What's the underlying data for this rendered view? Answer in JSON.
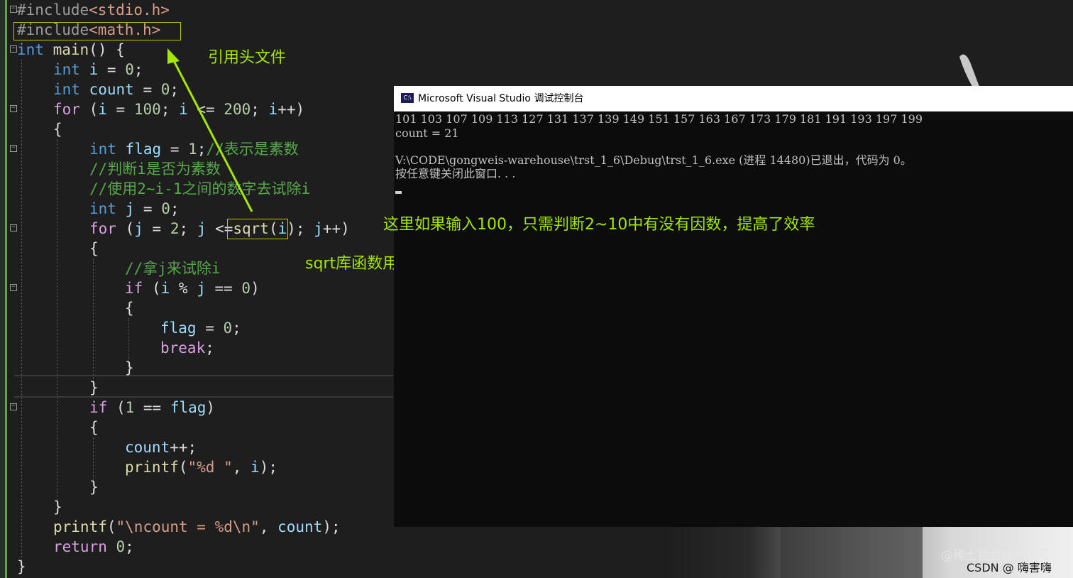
{
  "code": {
    "include1_pp": "#include",
    "include1_file": "<stdio.h>",
    "include2_pp": "#include",
    "include2_file": "<math.h>",
    "l3_kw": "int",
    "l3_fn": "main",
    "l3_rest": "() {",
    "l4_kw": "int",
    "l4_var": "i",
    "l4_eq": " = ",
    "l4_num": "0",
    "l4_semi": ";",
    "l5_kw": "int",
    "l5_var": "count",
    "l5_eq": " = ",
    "l5_num": "0",
    "l5_semi": ";",
    "l6_ctl": "for",
    "l6_a": " (",
    "l6_v1": "i",
    "l6_b": " = ",
    "l6_n1": "100",
    "l6_c": "; ",
    "l6_v2": "i",
    "l6_d": " <= ",
    "l6_n2": "200",
    "l6_e": "; ",
    "l6_v3": "i",
    "l6_f": "++)",
    "l7": "{",
    "l8_kw": "int",
    "l8_var": "flag",
    "l8_eq": " = ",
    "l8_num": "1",
    "l8_semi": ";",
    "l8_cmt": "//表示是素数",
    "l9_cmt": "//判断i是否为素数",
    "l10_cmt": "//使用2~i-1之间的数字去试除i",
    "l11_kw": "int",
    "l11_var": "j",
    "l11_eq": " = ",
    "l11_num": "0",
    "l11_semi": ";",
    "l12_ctl": "for",
    "l12_a": " (",
    "l12_v1": "j",
    "l12_b": " = ",
    "l12_n1": "2",
    "l12_c": "; ",
    "l12_v2": "j",
    "l12_d": " <=",
    "l12_fn": "sqrt",
    "l12_e": "(",
    "l12_v3": "i",
    "l12_f": "); ",
    "l12_v4": "j",
    "l12_g": "++)",
    "l13": "{",
    "l14_cmt": "//拿j来试除i",
    "l15_ctl": "if",
    "l15_a": " (",
    "l15_v1": "i",
    "l15_b": " % ",
    "l15_v2": "j",
    "l15_c": " == ",
    "l15_n": "0",
    "l15_d": ")",
    "l16": "{",
    "l17_var": "flag",
    "l17_eq": " = ",
    "l17_num": "0",
    "l17_semi": ";",
    "l18_ctl": "break",
    "l18_semi": ";",
    "l19": "}",
    "l20": "}",
    "l21_ctl": "if",
    "l21_a": " (",
    "l21_n": "1",
    "l21_b": " == ",
    "l21_v": "flag",
    "l21_c": ")",
    "l22": "{",
    "l23_var": "count",
    "l23_rest": "++;",
    "l24_fn": "printf",
    "l24_a": "(",
    "l24_str": "\"%d \"",
    "l24_b": ", ",
    "l24_v": "i",
    "l24_c": ");",
    "l25": "}",
    "l26": "}",
    "l27_fn": "printf",
    "l27_a": "(",
    "l27_str": "\"\\ncount = %d\\n\"",
    "l27_b": ", ",
    "l27_v": "count",
    "l27_c": ");",
    "l28_ctl": "return",
    "l28_sp": " ",
    "l28_num": "0",
    "l28_semi": ";",
    "l29": "}"
  },
  "annotations": {
    "header_note": "引用头文件",
    "sqrt_note": "sqrt库函数用于开平方",
    "efficiency_note": "这里如果输入100，只需判断2~10中有没有因数，提高了效率"
  },
  "console": {
    "icon_text": "C:\\",
    "title": "Microsoft Visual Studio 调试控制台",
    "primes": "101 103 107 109 113 127 131 137 139 149 151 157 163 167 173 179 181 191 193 197 199",
    "count_line": "count = 21",
    "exit_line": "V:\\CODE\\gongweis-warehouse\\trst_1_6\\Debug\\trst_1_6.exe (进程 14480)已退出，代码为 0。",
    "press_key": "按任意键关闭此窗口. . ."
  },
  "watermark": {
    "site": "@稀土掘金技术社区",
    "author": "CSDN @    嗨害嗨"
  },
  "colors": {
    "annotation": "#a3e600",
    "keyword": "#569cd6",
    "control": "#d8a0df",
    "function": "#dcdcaa",
    "variable": "#9cdcfe",
    "number": "#b5cea8",
    "string": "#d69d85",
    "comment": "#57a64a"
  }
}
